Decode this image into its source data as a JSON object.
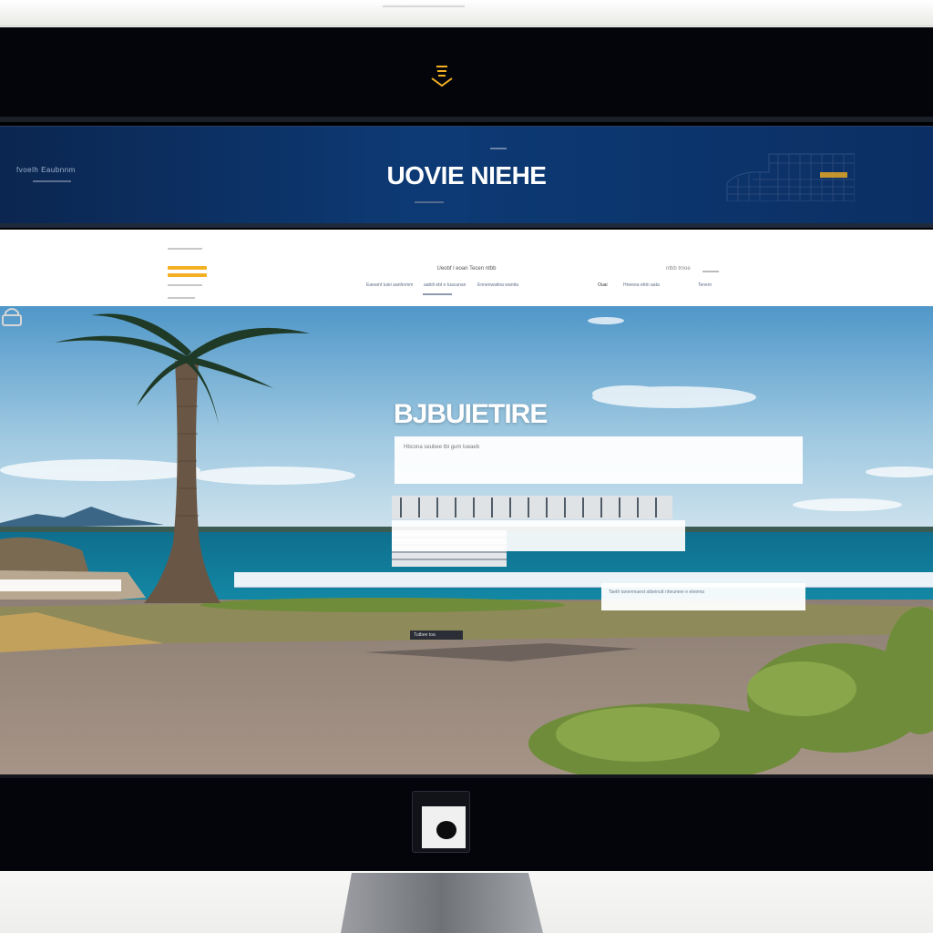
{
  "brand": {
    "title": "UOVIE NIEHE",
    "eyebrow": "fvoelh Eaubnnm"
  },
  "nav": {
    "center_heading": "Ueobf l eoan Tecen ntbb",
    "items": [
      "Eaeamt tuiei aanhnmm",
      "aabiti ebt e tuacanan",
      "Ennenwaitna wantta"
    ],
    "right_small": "ulua",
    "right_heading": "ntbb tmoe",
    "right_items": [
      "Ouai",
      "Hneeea ebtn aata",
      "Tenem"
    ]
  },
  "hero": {
    "title": "BJBUIETIRE",
    "card_text": "Hbcona seubee tbi gum lueaeb",
    "band_text": "Taeth tanenmaeot atbeinutt nheumee e eteema",
    "chip": "Tutbee toa"
  },
  "colors": {
    "accent": "#f3b023",
    "banner_blue": "#0d3a75",
    "bezel": "#03050b"
  },
  "icons": [
    "monitor-logo-icon",
    "lock-icon",
    "app-widget-icon"
  ]
}
